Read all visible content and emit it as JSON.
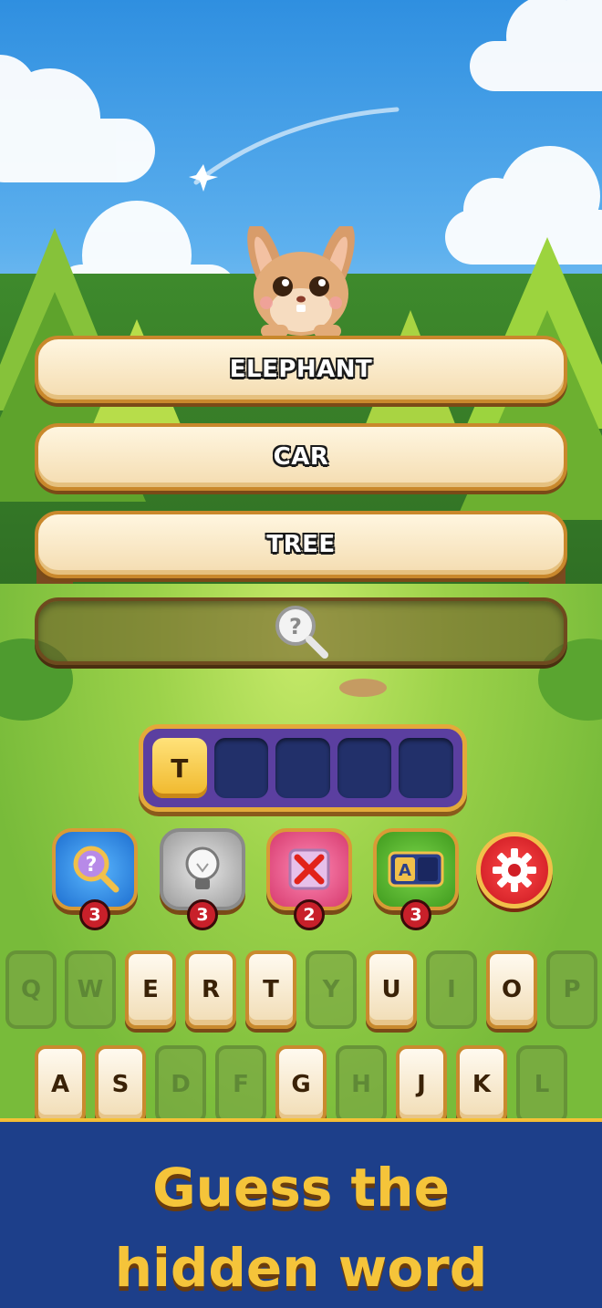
{
  "words": {
    "word1": "ELEPHANT",
    "word2": "CAR",
    "word3": "TREE",
    "hidden_icon": "magnifier-question-icon"
  },
  "answer_slots": {
    "letters": [
      "T",
      "",
      "",
      "",
      ""
    ]
  },
  "powerups": [
    {
      "icon": "magnifier-question-icon",
      "count": "3",
      "color": "#2a86e8"
    },
    {
      "icon": "lightbulb-icon",
      "count": "3",
      "color": "#a9a9a9"
    },
    {
      "icon": "cross-out-icon",
      "count": "2",
      "color": "#e8457a"
    },
    {
      "icon": "letter-reveal-icon",
      "count": "3",
      "color": "#4aa52a"
    },
    {
      "icon": "gear-icon"
    }
  ],
  "keyboard": {
    "row1": [
      {
        "letter": "Q",
        "enabled": false
      },
      {
        "letter": "W",
        "enabled": false
      },
      {
        "letter": "E",
        "enabled": true
      },
      {
        "letter": "R",
        "enabled": true
      },
      {
        "letter": "T",
        "enabled": true
      },
      {
        "letter": "Y",
        "enabled": false
      },
      {
        "letter": "U",
        "enabled": true
      },
      {
        "letter": "I",
        "enabled": false
      },
      {
        "letter": "O",
        "enabled": true
      },
      {
        "letter": "P",
        "enabled": false
      }
    ],
    "row2": [
      {
        "letter": "A",
        "enabled": true
      },
      {
        "letter": "S",
        "enabled": true
      },
      {
        "letter": "D",
        "enabled": false
      },
      {
        "letter": "F",
        "enabled": false
      },
      {
        "letter": "G",
        "enabled": true
      },
      {
        "letter": "H",
        "enabled": false
      },
      {
        "letter": "J",
        "enabled": true
      },
      {
        "letter": "K",
        "enabled": true
      },
      {
        "letter": "L",
        "enabled": false
      }
    ]
  },
  "banner": {
    "line1": "Guess the",
    "line2": "hidden word"
  },
  "colors": {
    "sky": "#5db0ee",
    "grass": "#9cd24a",
    "banner_bg": "#1d3f8a",
    "banner_text": "#f5c43a"
  }
}
